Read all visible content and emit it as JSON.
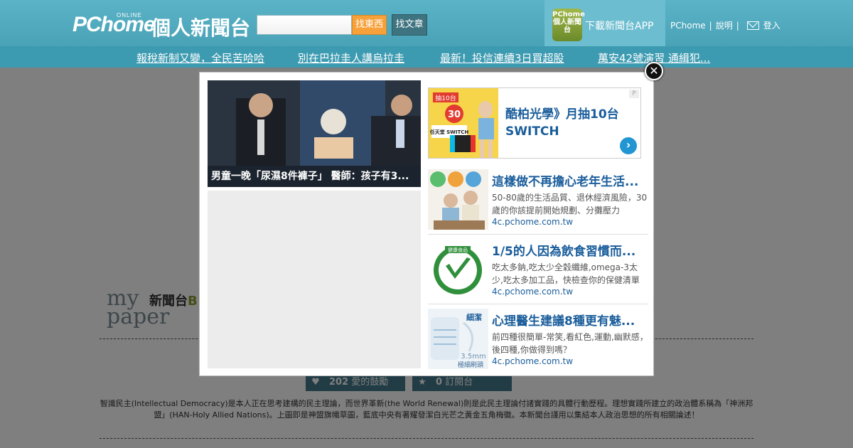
{
  "header": {
    "logo_pchome": "PChome",
    "logo_online": "ONLINE",
    "logo_cn": "個人新聞台",
    "search_placeholder": "",
    "find_item_label": "找東西",
    "find_article_label": "找文章",
    "app_icon_text": "PChome個人新聞台",
    "app_label": "下載新聞台APP",
    "links": {
      "pchome": "PChome",
      "help": "說明",
      "login": "登入",
      "sep": "|"
    }
  },
  "news_ticker": [
    "報稅新制又變，全民苦哈哈",
    "別在巴拉圭人講烏拉圭",
    "最新！投信連續3日買超股",
    "萬安42號演習 通緝犯..."
  ],
  "modal": {
    "close_glyph": "✕",
    "feature": {
      "caption": "男童一晚「尿濕8件褲子」 醫師：孩子有3..."
    },
    "ad_banner": {
      "title": "酷柏光學》月抽10台SWITCH",
      "badge": "P",
      "img_top": "抽10台",
      "img_big": "30",
      "img_label": "任天堂 SWITCH",
      "arrow": "›"
    },
    "ads": [
      {
        "title": "這樣做不再擔心老年生活...",
        "desc": "50-80歲的生活品質、退休經濟風險，30歲的你該提前開始規劃、分攤壓力",
        "src": "4c.pchome.com.tw"
      },
      {
        "title": "1/5的人因為飲食習慣而...",
        "desc": "吃太多鈉,吃太少全穀纖維,omega-3太少,吃太多加工品，快檢查你的保健清單",
        "src": "4c.pchome.com.tw"
      },
      {
        "title": "心理醫生建議8種更有魅...",
        "desc": "前四種很簡單-常笑,看紅色,運動,幽默感，後四種,你做得到嗎？",
        "src": "4c.pchome.com.tw"
      }
    ],
    "thumb_text": {
      "ad2_label": "健康食品",
      "ad3_label1": "細潔",
      "ad3_label2": "3.5mm",
      "ad3_label3": "極細刷頭"
    }
  },
  "page": {
    "mypaper_my": "my",
    "mypaper_paper": "paper",
    "mypaper_blog": "新聞台",
    "mypaper_blog_b": "B",
    "stats": [
      {
        "count": "202",
        "label": "愛的鼓勵",
        "icon": "heart-icon",
        "glyph": "♥"
      },
      {
        "count": "0",
        "label": "訂閱台",
        "icon": "star-icon",
        "glyph": "★"
      }
    ],
    "intro": "智識民主(Intellectual Democracy)是本人正在思考建構的民主理論，而世界革新(the World Renewal)則是此民主理論付諸實踐的具體行動歷程。理想實踐所建立的政治體系稱為「神洲邦盟」(HAN-Holy Allied Nations)。上圖即是神盟旗幟草圖，藍底中央有著耀發潔白光芒之黃金五角梅徽。本新聞台謹用以集結本人政治思想的所有相關論述！"
  },
  "colors": {
    "header_teal": "#4aa2b7",
    "newsbar": "#3d9bb1",
    "search_btn": "#f7a13b",
    "link_blue": "#1a5d9b"
  }
}
